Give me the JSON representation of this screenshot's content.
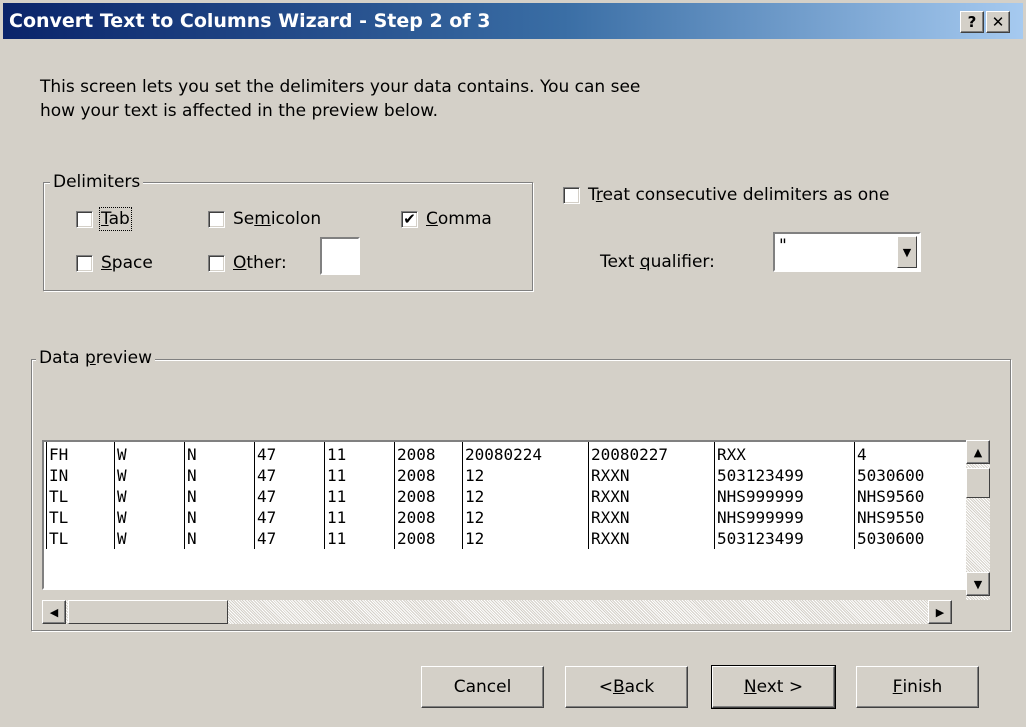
{
  "window": {
    "title": "Convert Text to Columns Wizard - Step 2 of 3",
    "help_label": "?",
    "close_label": "✕"
  },
  "intro": {
    "line1": "This screen lets you set the delimiters your data contains.  You can see",
    "line2": "how your text is affected in the preview below."
  },
  "delimiters": {
    "legend": "Delimiters",
    "tab": {
      "pre": "",
      "key": "T",
      "post": "ab",
      "checked": false
    },
    "semicolon": {
      "pre": "Se",
      "key": "m",
      "post": "icolon",
      "checked": false
    },
    "comma": {
      "pre": "",
      "key": "C",
      "post": "omma",
      "checked": true
    },
    "space": {
      "pre": "",
      "key": "S",
      "post": "pace",
      "checked": false
    },
    "other": {
      "pre": "",
      "key": "O",
      "post": "ther:",
      "checked": false,
      "value": ""
    }
  },
  "consecutive": {
    "pre": "T",
    "key": "r",
    "post": "eat consecutive delimiters as one",
    "checked": false
  },
  "qualifier": {
    "label_pre": "Text ",
    "label_key": "q",
    "label_post": "ualifier:",
    "value": "\""
  },
  "preview": {
    "legend_pre": "Data ",
    "legend_key": "p",
    "legend_post": "review",
    "rows": [
      [
        "FH",
        "W",
        "N",
        "47",
        "11",
        "2008",
        "20080224",
        "20080227",
        "RXX",
        "4"
      ],
      [
        "IN",
        "W",
        "N",
        "47",
        "11",
        "2008",
        "12",
        "RXXN",
        "503123499",
        "5030600"
      ],
      [
        "TL",
        "W",
        "N",
        "47",
        "11",
        "2008",
        "12",
        "RXXN",
        "NHS999999",
        "NHS9560"
      ],
      [
        "TL",
        "W",
        "N",
        "47",
        "11",
        "2008",
        "12",
        "RXXN",
        "NHS999999",
        "NHS9550"
      ],
      [
        "TL",
        "W",
        "N",
        "47",
        "11",
        "2008",
        "12",
        "RXXN",
        "503123499",
        "5030600"
      ]
    ]
  },
  "buttons": {
    "cancel": {
      "pre": "Cancel",
      "key": "",
      "post": ""
    },
    "back": {
      "pre": "< ",
      "key": "B",
      "post": "ack"
    },
    "next": {
      "pre": "",
      "key": "N",
      "post": "ext >"
    },
    "finish": {
      "pre": "",
      "key": "F",
      "post": "inish"
    }
  },
  "icons": {
    "check_mark": "✔",
    "arrow_up": "▲",
    "arrow_down": "▼",
    "arrow_left": "◀",
    "arrow_right": "▶"
  }
}
